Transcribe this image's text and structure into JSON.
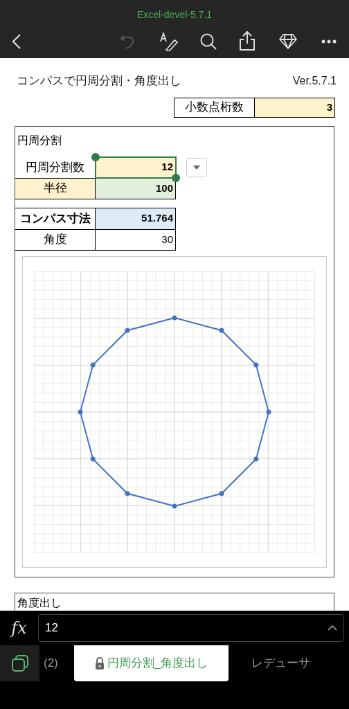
{
  "app_bar": {
    "title": "Excel-devel-5.7.1"
  },
  "sheet": {
    "title": "コンパスで円周分割・角度出し",
    "version": "Ver.5.7.1",
    "decimal_places": {
      "label": "小数点桁数",
      "value": "3"
    },
    "circle_section": {
      "title": "円周分割",
      "input_rows": [
        {
          "label": "円周分割数",
          "value": "12",
          "kind": "count",
          "selected": true
        },
        {
          "label": "半径",
          "value": "100",
          "kind": "radius",
          "selected": false
        }
      ],
      "result_rows": [
        {
          "label": "コンパス寸法",
          "value": "51.764",
          "kind": "result",
          "selected": false
        },
        {
          "label": "角度",
          "value": "30",
          "kind": "plain",
          "selected": false
        }
      ]
    },
    "angle_section": {
      "title": "角度出し"
    }
  },
  "formula_bar": {
    "function_label": "fx",
    "value": "12"
  },
  "sheet_tabs": [
    {
      "label": "(2)",
      "selected": false,
      "locked": false
    },
    {
      "label": "円周分割_角度出し",
      "selected": true,
      "locked": true
    },
    {
      "label": "レデューサ",
      "selected": false,
      "locked": false
    }
  ]
}
